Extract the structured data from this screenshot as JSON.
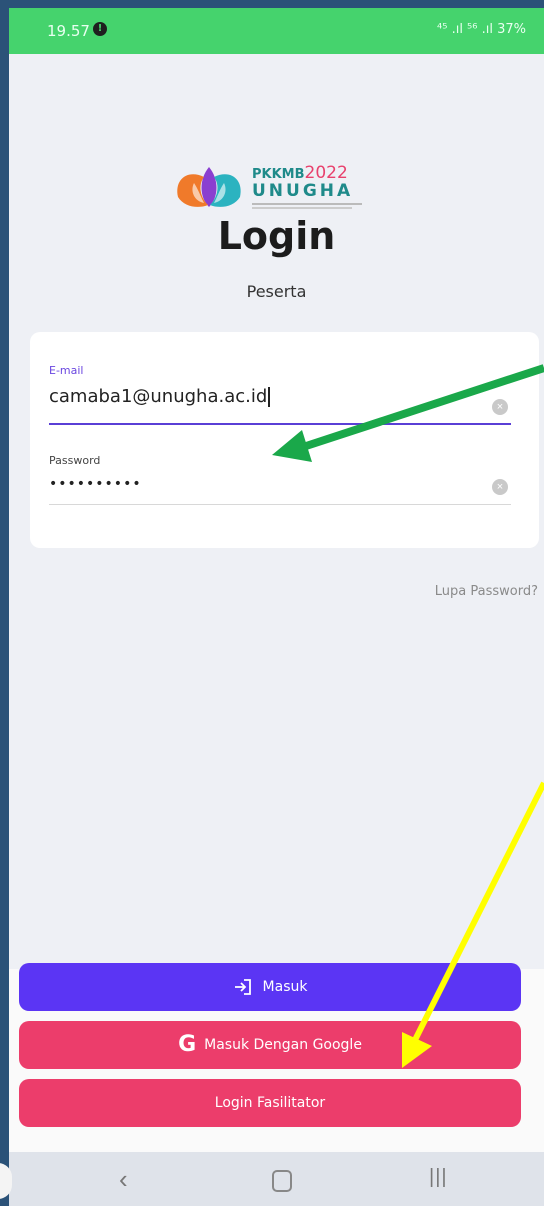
{
  "status_bar": {
    "time": "19.57",
    "right_indicators": "⁴⁵ .ıl ⁵⁶ .ıl 37%"
  },
  "header": {
    "logo_text_top": "PKKMB",
    "logo_year": "2022",
    "logo_text_bottom": "UNUGHA",
    "title": "Login",
    "subtitle": "Peserta"
  },
  "form": {
    "email_label": "E-mail",
    "email_value": "camaba1@unugha.ac.id",
    "password_label": "Password",
    "password_value": "••••••••••"
  },
  "links": {
    "forgot_password": "Lupa Password?"
  },
  "buttons": {
    "masuk": "Masuk",
    "google": "Masuk Dengan Google",
    "fasilitator": "Login Fasilitator"
  },
  "colors": {
    "status_bar": "#45d36d",
    "primary": "#5b35f4",
    "secondary": "#ec3d6b",
    "annotation_green": "#1aa84a",
    "annotation_yellow": "#ffff00"
  },
  "icons": {
    "login": "login-icon",
    "google": "google-icon",
    "clear": "clear-icon",
    "nav_back": "back-icon",
    "nav_home": "home-icon",
    "nav_recent": "recent-apps-icon"
  }
}
